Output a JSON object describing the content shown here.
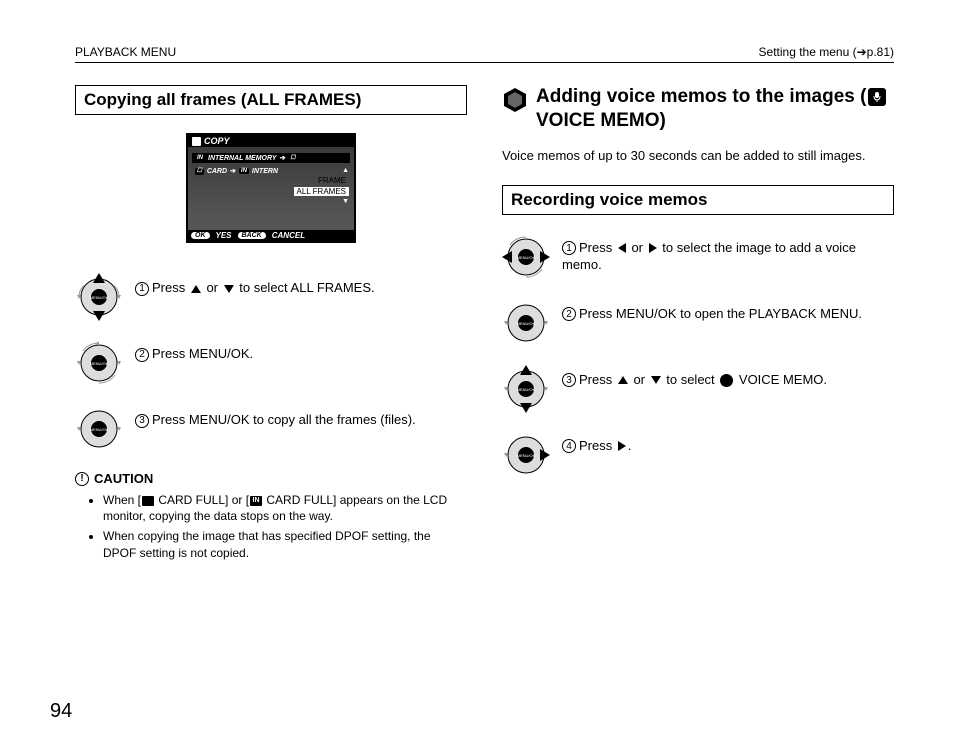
{
  "header": {
    "left": "PLAYBACK MENU",
    "right_prefix": "Setting the menu (",
    "right_arrow": "➔",
    "right_page": "p.81)"
  },
  "left_col": {
    "title": "Copying all frames (ALL FRAMES)",
    "lcd": {
      "top": "COPY",
      "line1_a": "INTERNAL MEMORY",
      "line1_b": "",
      "line2_a": "CARD",
      "line2_b": "INTERN",
      "opt_frame": "FRAME",
      "opt_all": "ALL FRAMES",
      "ok": "OK",
      "yes": "YES",
      "back": "BACK",
      "cancel": "CANCEL"
    },
    "steps": [
      {
        "num": "1",
        "pre": "Press ",
        "mid": " or ",
        "post": " to select ALL FRAMES.",
        "dir": "ud"
      },
      {
        "num": "2",
        "pre": "Press MENU/OK.",
        "mid": "",
        "post": "",
        "dir": "c"
      },
      {
        "num": "3",
        "pre": "Press MENU/OK to copy all the frames (files).",
        "mid": "",
        "post": "",
        "dir": "c"
      }
    ],
    "caution_label": "CAUTION",
    "caution_items": [
      {
        "pre": "When [",
        "mid1": " CARD FULL] or [",
        "mid2": " CARD FULL] appears on the LCD monitor, copying the data stops on the way."
      },
      {
        "pre": "When copying the image that has specified DPOF setting, the DPOF setting is not copied.",
        "mid1": "",
        "mid2": ""
      }
    ]
  },
  "right_col": {
    "heading_a": "Adding voice memos to the images (",
    "heading_b": " VOICE MEMO)",
    "intro": "Voice memos of up to 30 seconds can be added to still images.",
    "subsection": "Recording voice memos",
    "steps": [
      {
        "num": "1",
        "pre": "Press ",
        "mid": " or ",
        "post": " to select the image to add a voice memo.",
        "dir": "lr"
      },
      {
        "num": "2",
        "pre": "Press MENU/OK to open the PLAYBACK MENU.",
        "mid": "",
        "post": "",
        "dir": "c"
      },
      {
        "num": "3",
        "pre": "Press ",
        "mid": " or ",
        "post_a": " to select ",
        "post_b": " VOICE MEMO.",
        "dir": "ud"
      },
      {
        "num": "4",
        "pre": "Press ",
        "mid": "",
        "post": ".",
        "dir": "r"
      }
    ]
  },
  "page_number": "94"
}
